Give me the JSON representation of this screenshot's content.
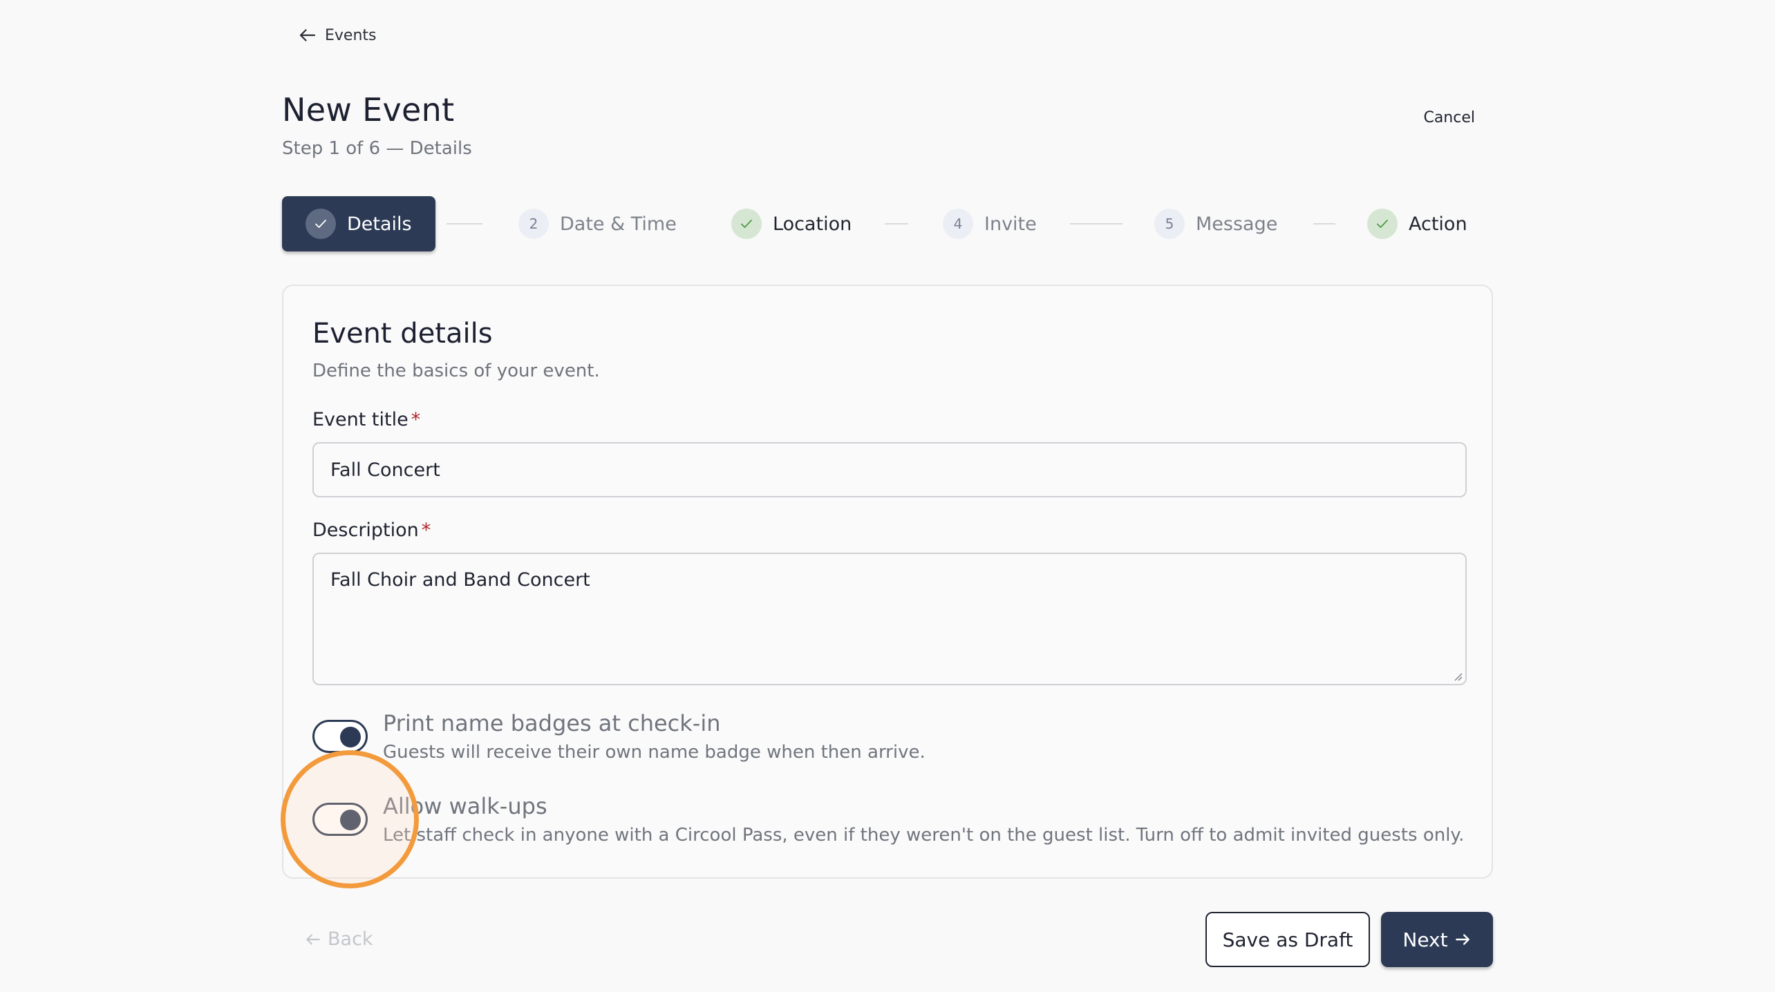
{
  "nav": {
    "back_label": "Events"
  },
  "header": {
    "title": "New Event",
    "subtitle": "Step 1 of 6 — Details",
    "cancel_label": "Cancel"
  },
  "stepper": {
    "steps": [
      {
        "number": "",
        "label": "Details",
        "state": "active"
      },
      {
        "number": "2",
        "label": "Date & Time",
        "state": "pending"
      },
      {
        "number": "",
        "label": "Location",
        "state": "complete"
      },
      {
        "number": "4",
        "label": "Invite",
        "state": "pending"
      },
      {
        "number": "5",
        "label": "Message",
        "state": "pending"
      },
      {
        "number": "",
        "label": "Action",
        "state": "complete"
      }
    ]
  },
  "card": {
    "title": "Event details",
    "description": "Define the basics of your event.",
    "fields": {
      "event_title": {
        "label": "Event title",
        "required_mark": "*",
        "value": "Fall Concert"
      },
      "description": {
        "label": "Description",
        "required_mark": "*",
        "value": "Fall Choir and Band Concert"
      }
    },
    "toggles": [
      {
        "title": "Print name badges at check-in",
        "description": "Guests will receive their own name badge when then arrive.",
        "on": true
      },
      {
        "title": "Allow walk-ups",
        "description": "Let staff check in anyone with a Circool Pass, even if they weren't on the guest list. Turn off to admit invited guests only.",
        "on": true
      }
    ]
  },
  "footer": {
    "back_label": "Back",
    "save_draft_label": "Save as Draft",
    "next_label": "Next"
  },
  "colors": {
    "primary": "#2c3a55",
    "highlight_ring": "#f29a3c",
    "complete_badge": "#d5e6d2",
    "required": "#b2262c"
  }
}
